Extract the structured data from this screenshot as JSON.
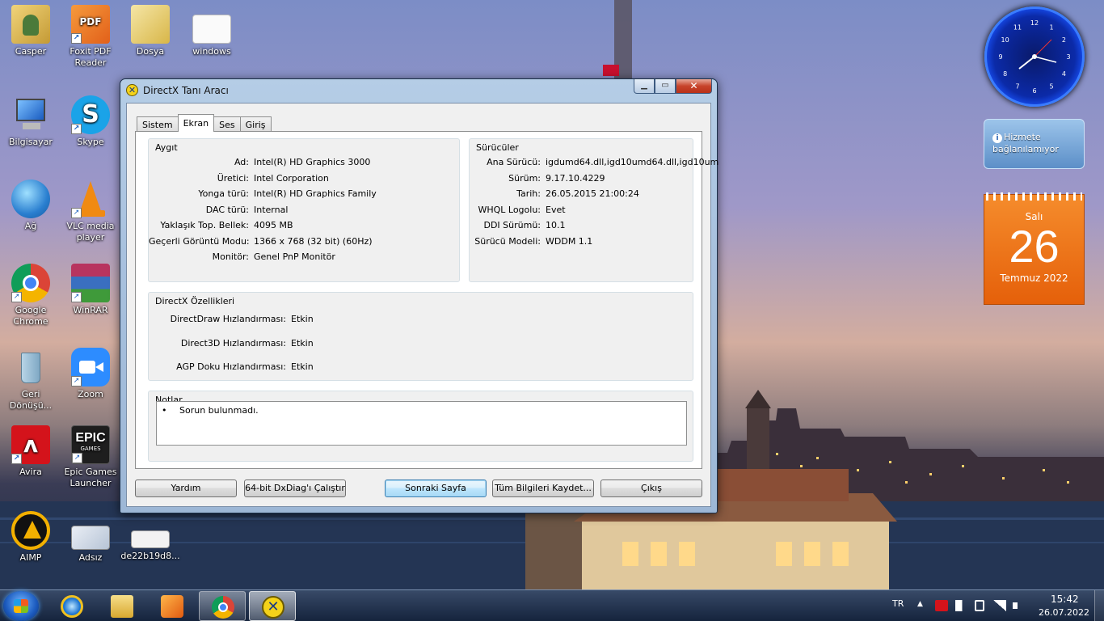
{
  "desktop_icons": [
    {
      "label": "Casper",
      "color": "#d7b45a"
    },
    {
      "label": "Foxit PDF Reader",
      "color": "#e8752d"
    },
    {
      "label": "Dosya",
      "color": "#e8d68a"
    },
    {
      "label": "windows",
      "color": "#f2f2f2"
    },
    {
      "label": "Bilgisayar",
      "color": "#3b7fd1"
    },
    {
      "label": "Skype",
      "color": "#1aa3e8"
    },
    {
      "label": "Ağ",
      "color": "#2d8ad6"
    },
    {
      "label": "VLC media player",
      "color": "#f08a12"
    },
    {
      "label": "Google Chrome",
      "color": "#3f9c45"
    },
    {
      "label": "WinRAR",
      "color": "#8e2f76"
    },
    {
      "label": "Geri Dönüşü...",
      "color": "#8fb7cc"
    },
    {
      "label": "Zoom",
      "color": "#2d8cff"
    },
    {
      "label": "Avira",
      "color": "#d4131b"
    },
    {
      "label": "Epic Games Launcher",
      "color": "#1e1e1e"
    },
    {
      "label": "AIMP",
      "color": "#f2b000"
    },
    {
      "label": "Adsız",
      "color": "#cfd8e6"
    },
    {
      "label": "de22b19d8...",
      "color": "#eeeeee"
    }
  ],
  "epic_logo_text": "EPIC",
  "epic_logo_sub": "GAMES",
  "foxit_badge": "PDF",
  "gadgets": {
    "service_text": "Hizmete bağlanılamıyor",
    "calendar_day_name": "Salı",
    "calendar_day_number": "26",
    "calendar_month": "Temmuz 2022",
    "clock_numbers": [
      "12",
      "1",
      "2",
      "3",
      "4",
      "5",
      "6",
      "7",
      "8",
      "9",
      "10",
      "11"
    ]
  },
  "window": {
    "title": "DirectX Tanı Aracı",
    "caption_buttons": {
      "minimize": "▁",
      "maximize": "▭",
      "close": "✕"
    },
    "tabs": [
      "Sistem",
      "Ekran",
      "Ses",
      "Giriş"
    ],
    "active_tab": "Ekran",
    "device_group": {
      "title": "Aygıt",
      "rows": [
        {
          "key": "Ad:",
          "value": "Intel(R) HD Graphics 3000"
        },
        {
          "key": "Üretici:",
          "value": "Intel Corporation"
        },
        {
          "key": "Yonga türü:",
          "value": "Intel(R) HD Graphics Family"
        },
        {
          "key": "DAC türü:",
          "value": "Internal"
        },
        {
          "key": "Yaklaşık Top. Bellek:",
          "value": "4095 MB"
        },
        {
          "key": "Geçerli Görüntü Modu:",
          "value": "1366 x 768 (32 bit) (60Hz)"
        },
        {
          "key": "Monitör:",
          "value": "Genel PnP Monitör"
        }
      ]
    },
    "drivers_group": {
      "title": "Sürücüler",
      "rows": [
        {
          "key": "Ana Sürücü:",
          "value": "igdumd64.dll,igd10umd64.dll,igd10um"
        },
        {
          "key": "Sürüm:",
          "value": "9.17.10.4229"
        },
        {
          "key": "Tarih:",
          "value": "26.05.2015 21:00:24"
        },
        {
          "key": "WHQL Logolu:",
          "value": "Evet"
        },
        {
          "key": "DDI Sürümü:",
          "value": "10.1"
        },
        {
          "key": "Sürücü Modeli:",
          "value": "WDDM 1.1"
        }
      ]
    },
    "features_group": {
      "title": "DirectX Özellikleri",
      "rows": [
        {
          "key": "DirectDraw Hızlandırması:",
          "value": "Etkin"
        },
        {
          "key": "Direct3D Hızlandırması:",
          "value": "Etkin"
        },
        {
          "key": "AGP Doku Hızlandırması:",
          "value": "Etkin"
        }
      ]
    },
    "notes_group": {
      "title": "Notlar",
      "bullet": "•",
      "items": [
        "Sorun bulunmadı."
      ]
    },
    "buttons": {
      "help": "Yardım",
      "run64": "64-bit DxDiag'ı Çalıştır",
      "next_page": "Sonraki Sayfa",
      "save_all": "Tüm Bilgileri Kaydet...",
      "exit": "Çıkış"
    }
  },
  "taskbar": {
    "language": "TR",
    "time": "15:42",
    "date": "26.07.2022",
    "tray_arrow": "▲"
  }
}
